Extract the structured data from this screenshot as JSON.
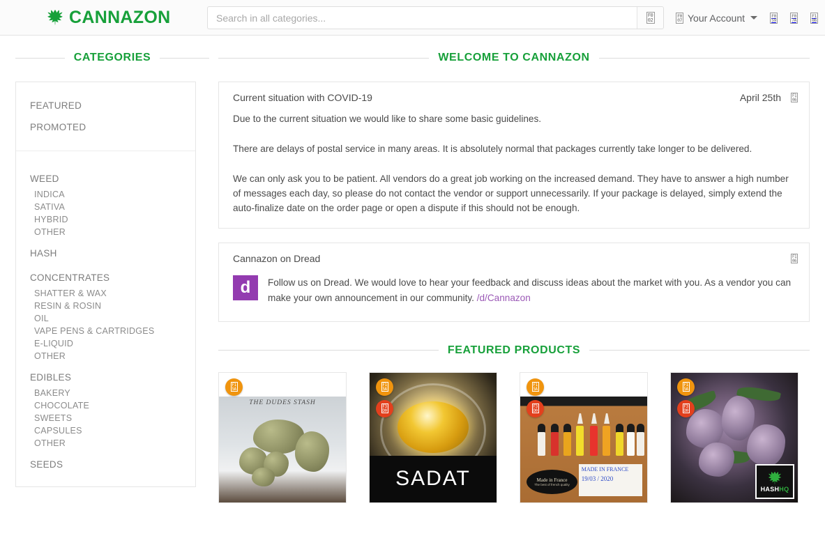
{
  "header": {
    "brand": "CANNAZON",
    "brand_color": "#17a03a",
    "leaf_icon": "cannabis-leaf-icon",
    "search": {
      "placeholder": "Search in all categories...",
      "value": "",
      "button_icon": "search-icon",
      "button_glyph": "F002"
    },
    "account_label": "Your Account",
    "account_icon": "user-icon",
    "account_glyph": "F007",
    "icons": [
      {
        "name": "help-icon",
        "glyph": "F059"
      },
      {
        "name": "shopping-cart-icon",
        "glyph": "F07A"
      },
      {
        "name": "night-mode-icon",
        "glyph": "F186"
      }
    ]
  },
  "sidebar": {
    "heading": "CATEGORIES",
    "top_items": [
      {
        "label": "FEATURED"
      },
      {
        "label": "PROMOTED"
      }
    ],
    "groups": [
      {
        "label": "WEED",
        "subs": [
          {
            "label": "INDICA"
          },
          {
            "label": "SATIVA"
          },
          {
            "label": "HYBRID"
          },
          {
            "label": "OTHER"
          }
        ]
      },
      {
        "label": "HASH",
        "subs": []
      },
      {
        "label": "CONCENTRATES",
        "subs": [
          {
            "label": "SHATTER & WAX"
          },
          {
            "label": "RESIN & ROSIN"
          },
          {
            "label": "OIL"
          },
          {
            "label": "VAPE PENS & CARTRIDGES"
          },
          {
            "label": "E-LIQUID"
          },
          {
            "label": "OTHER"
          }
        ]
      },
      {
        "label": "EDIBLES",
        "subs": [
          {
            "label": "BAKERY"
          },
          {
            "label": "CHOCOLATE"
          },
          {
            "label": "SWEETS"
          },
          {
            "label": "CAPSULES"
          },
          {
            "label": "OTHER"
          }
        ]
      },
      {
        "label": "SEEDS",
        "subs": []
      }
    ]
  },
  "main": {
    "welcome_heading": "WELCOME TO CANNAZON",
    "announcement": {
      "title": "Current situation with COVID-19",
      "date": "April 25th",
      "collapse_icon": "chevron-up-icon",
      "collapse_glyph": "F106",
      "paragraphs": [
        "Due to the current situation we would like to share some basic guidelines.",
        "There are delays of postal service in many areas. It is absolutely normal that packages currently take longer to be delivered.",
        "We can only ask you to be patient. All vendors do a great job working on the increased demand. They have to answer a high number of messages each day, so please do not contact the vendor or support unnecessarily. If your package is delayed, simply extend the auto-finalize date on the order page or open a dispute if this should not be enough."
      ]
    },
    "dread": {
      "title": "Cannazon on Dread",
      "collapse_icon": "chevron-up-icon",
      "collapse_glyph": "F106",
      "logo_letter": "d",
      "logo_color": "#933bb0",
      "text": "Follow us on Dread. We would love to hear your feedback and discuss ideas about the market with you. As a vendor you can make your own announcement in our community.",
      "link_label": "/d/Cannazon",
      "link_color": "#9b59b6"
    },
    "featured_heading": "FEATURED PRODUCTS",
    "badge_colors": {
      "orange": "#f0940e",
      "red": "#e3401d"
    },
    "products": [
      {
        "image_alt": "cannabis buds on grey background",
        "image_caption": "THE DUDES STASH",
        "badges": [
          {
            "name": "featured-badge",
            "glyph": "F15A",
            "color": "orange"
          }
        ],
        "layout": "offset"
      },
      {
        "image_alt": "amber cannabis concentrate in a glass jar",
        "image_caption": "SADAT",
        "badges": [
          {
            "name": "featured-badge",
            "glyph": "F15A",
            "color": "orange"
          },
          {
            "name": "promoted-badge",
            "glyph": "F3D0",
            "color": "red"
          }
        ],
        "layout": "full"
      },
      {
        "image_alt": "e-liquid bottles on a wooden table",
        "image_caption_oval": "Made in France",
        "image_caption_oval_sub": "The best of french quality",
        "image_caption_sign_line1": "MADE IN FRANCE",
        "image_caption_sign_line2": "19/03 / 2020",
        "badges": [
          {
            "name": "featured-badge",
            "glyph": "F15A",
            "color": "orange"
          },
          {
            "name": "promoted-badge",
            "glyph": "F3D0",
            "color": "red"
          }
        ],
        "layout": "offset"
      },
      {
        "image_alt": "purple cannabis plant in a pot",
        "image_caption_logo_white": "HASH",
        "image_caption_logo_green": "HQ",
        "badges": [
          {
            "name": "featured-badge",
            "glyph": "F15A",
            "color": "orange"
          },
          {
            "name": "promoted-badge",
            "glyph": "F3D0",
            "color": "red"
          }
        ],
        "layout": "full"
      }
    ]
  }
}
